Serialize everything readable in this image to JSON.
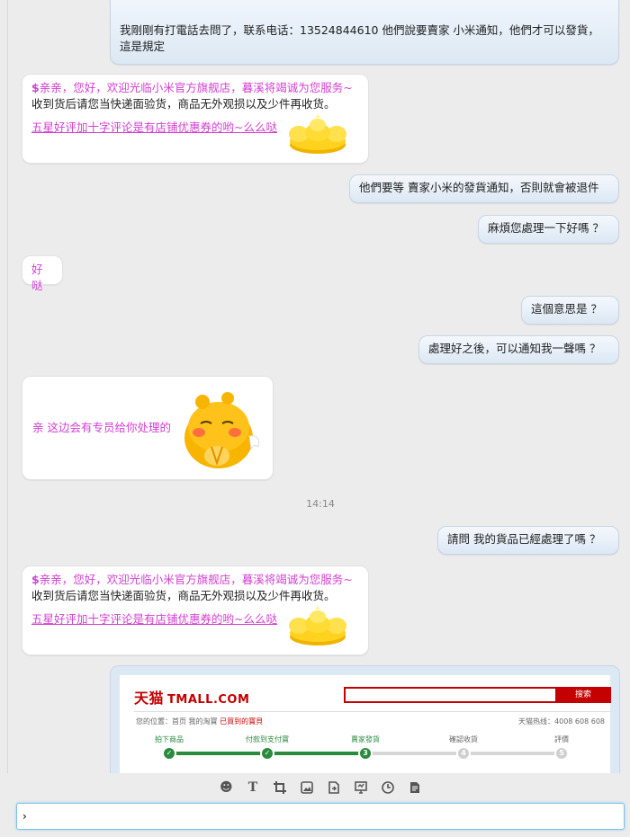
{
  "messages": {
    "m1": {
      "line1": "我剛剛有打電話去問了，联系电话：13524844610  他們說要賣家 小米通知，他們才可以發貨，",
      "line2": "這是規定"
    },
    "m2": {
      "dollar": "$",
      "greeting": "亲亲，您好，欢迎光临小米官方旗舰店，暮溪将竭诚为您服务~",
      "line2": "收到货后请您当快递面验货，商品无外观损以及少件再收货。",
      "link": "五星好评加十字评论是有店铺优惠券的哟~么么哒",
      "sticker": "gold-ingot"
    },
    "m3": "他們要等 賣家小米的發貨通知，否則就會被退件",
    "m4": "麻煩您處理一下好嗎 ？",
    "m5": "好哒",
    "m6": "這個意思是 ？",
    "m7": "處理好之後，可以通知我一聲嗎 ？",
    "m8": {
      "text": "亲 这边会有专员给你处理的",
      "sticker": "cute-chick-praying"
    },
    "timestamp": "14:14",
    "m9": "請問   我的貨品已經處理了嗎 ？",
    "m10": {
      "dollar": "$",
      "greeting": "亲亲，您好，欢迎光临小米官方旗舰店，暮溪将竭诚为您服务~",
      "line2": "收到货后请您当快递面验货，商品无外观损以及少件再收货。",
      "link": "五星好评加十字评论是有店铺优惠券的哟~么么哒",
      "sticker": "gold-ingot"
    }
  },
  "tmall": {
    "logo_cn": "天猫",
    "logo_en": "TMALL.COM",
    "search_button": "搜索",
    "breadcrumb_prefix": "您的位置：首页  我的淘寶  ",
    "breadcrumb_current": "已買到的寶貝",
    "hotline": "天猫热线：4008 608 608",
    "steps": [
      {
        "label": "拍下商品",
        "num": "1",
        "done": true
      },
      {
        "label": "付款到支付寶",
        "num": "2",
        "done": true
      },
      {
        "label": "賣家發貨",
        "num": "3",
        "done": true
      },
      {
        "label": "確認收貨",
        "num": "4",
        "done": false
      },
      {
        "label": "評價",
        "num": "5",
        "done": false
      }
    ]
  },
  "toolbar": {
    "icons": [
      "emoji-icon",
      "text-format-icon",
      "crop-icon",
      "image-icon",
      "file-icon",
      "screen-share-icon",
      "history-icon",
      "document-icon"
    ]
  },
  "input": {
    "value": "›"
  },
  "colors": {
    "accent_pink": "#d23fd0",
    "tmall_red": "#c40000",
    "done_green": "#2a8a3e"
  }
}
